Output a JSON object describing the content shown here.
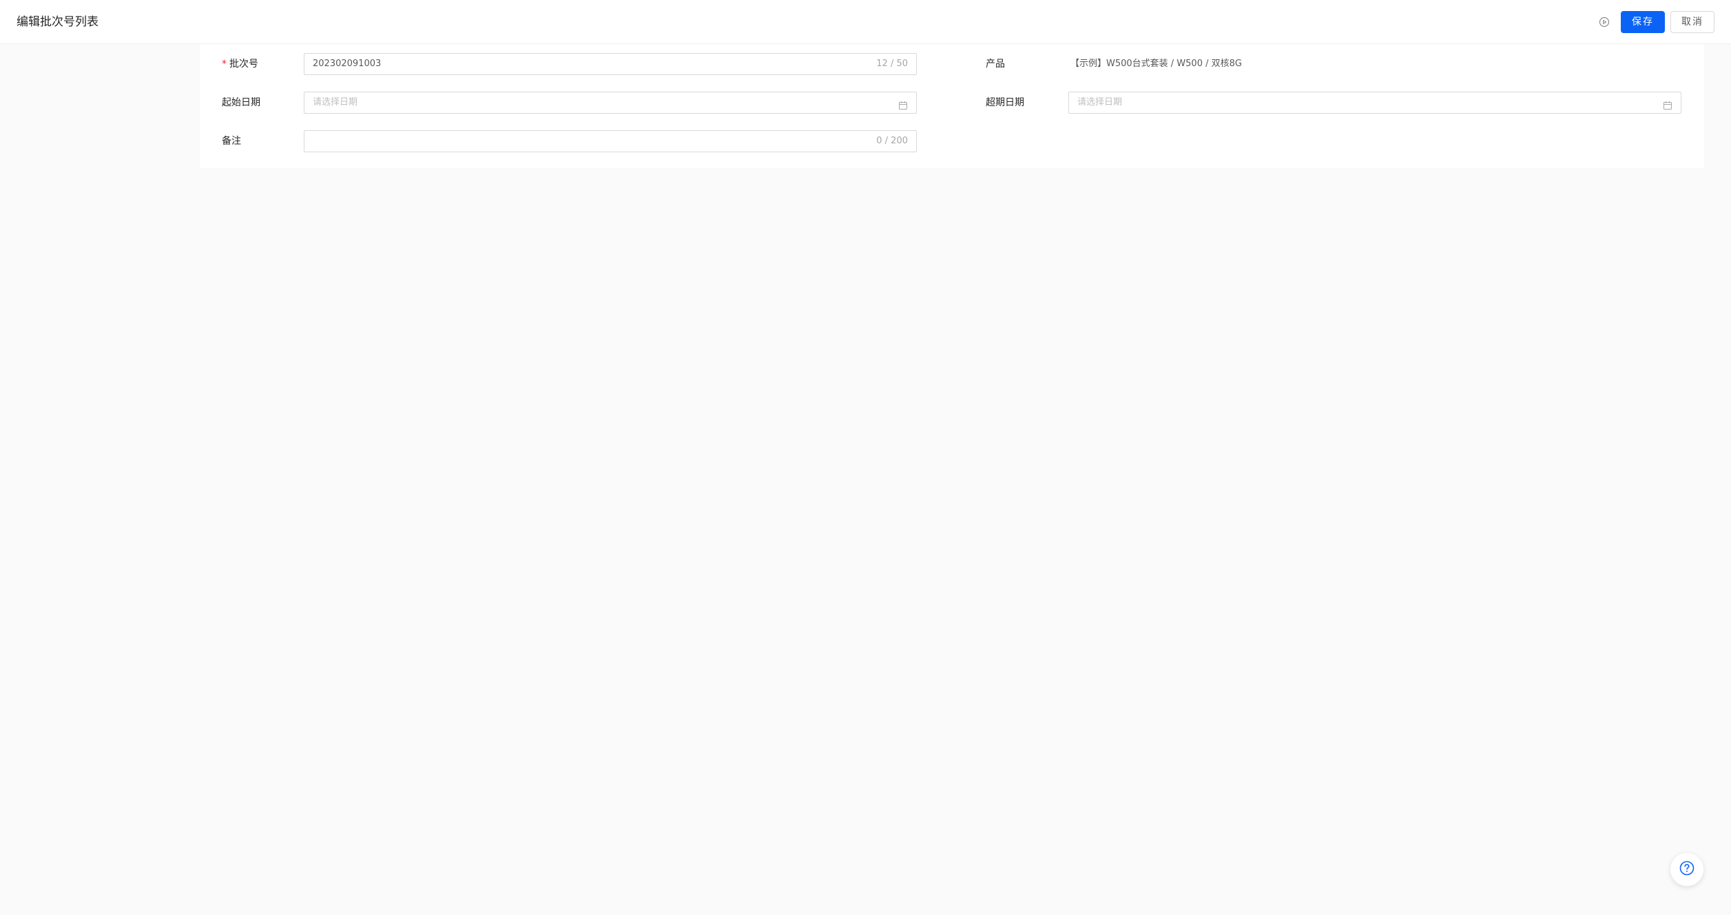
{
  "colors": {
    "accent": "#0b63f6",
    "required": "#f5222d",
    "background": "#fafafa"
  },
  "header": {
    "title": "编辑批次号列表",
    "play_icon": "play-circle-icon",
    "save_label": "保存",
    "cancel_label": "取消"
  },
  "form": {
    "batch_no": {
      "label": "批次号",
      "required_mark": "*",
      "value": "202302091003",
      "count": "12 / 50"
    },
    "product": {
      "label": "产品",
      "value": "【示例】W500台式套装 / W500 / 双核8G"
    },
    "start_date": {
      "label": "起始日期",
      "placeholder": "请选择日期",
      "icon": "calendar-icon"
    },
    "overdue_date": {
      "label": "超期日期",
      "placeholder": "请选择日期",
      "icon": "calendar-icon"
    },
    "remark": {
      "label": "备注",
      "value": "",
      "count": "0 / 200"
    }
  },
  "help": {
    "icon": "question-circle-icon"
  }
}
